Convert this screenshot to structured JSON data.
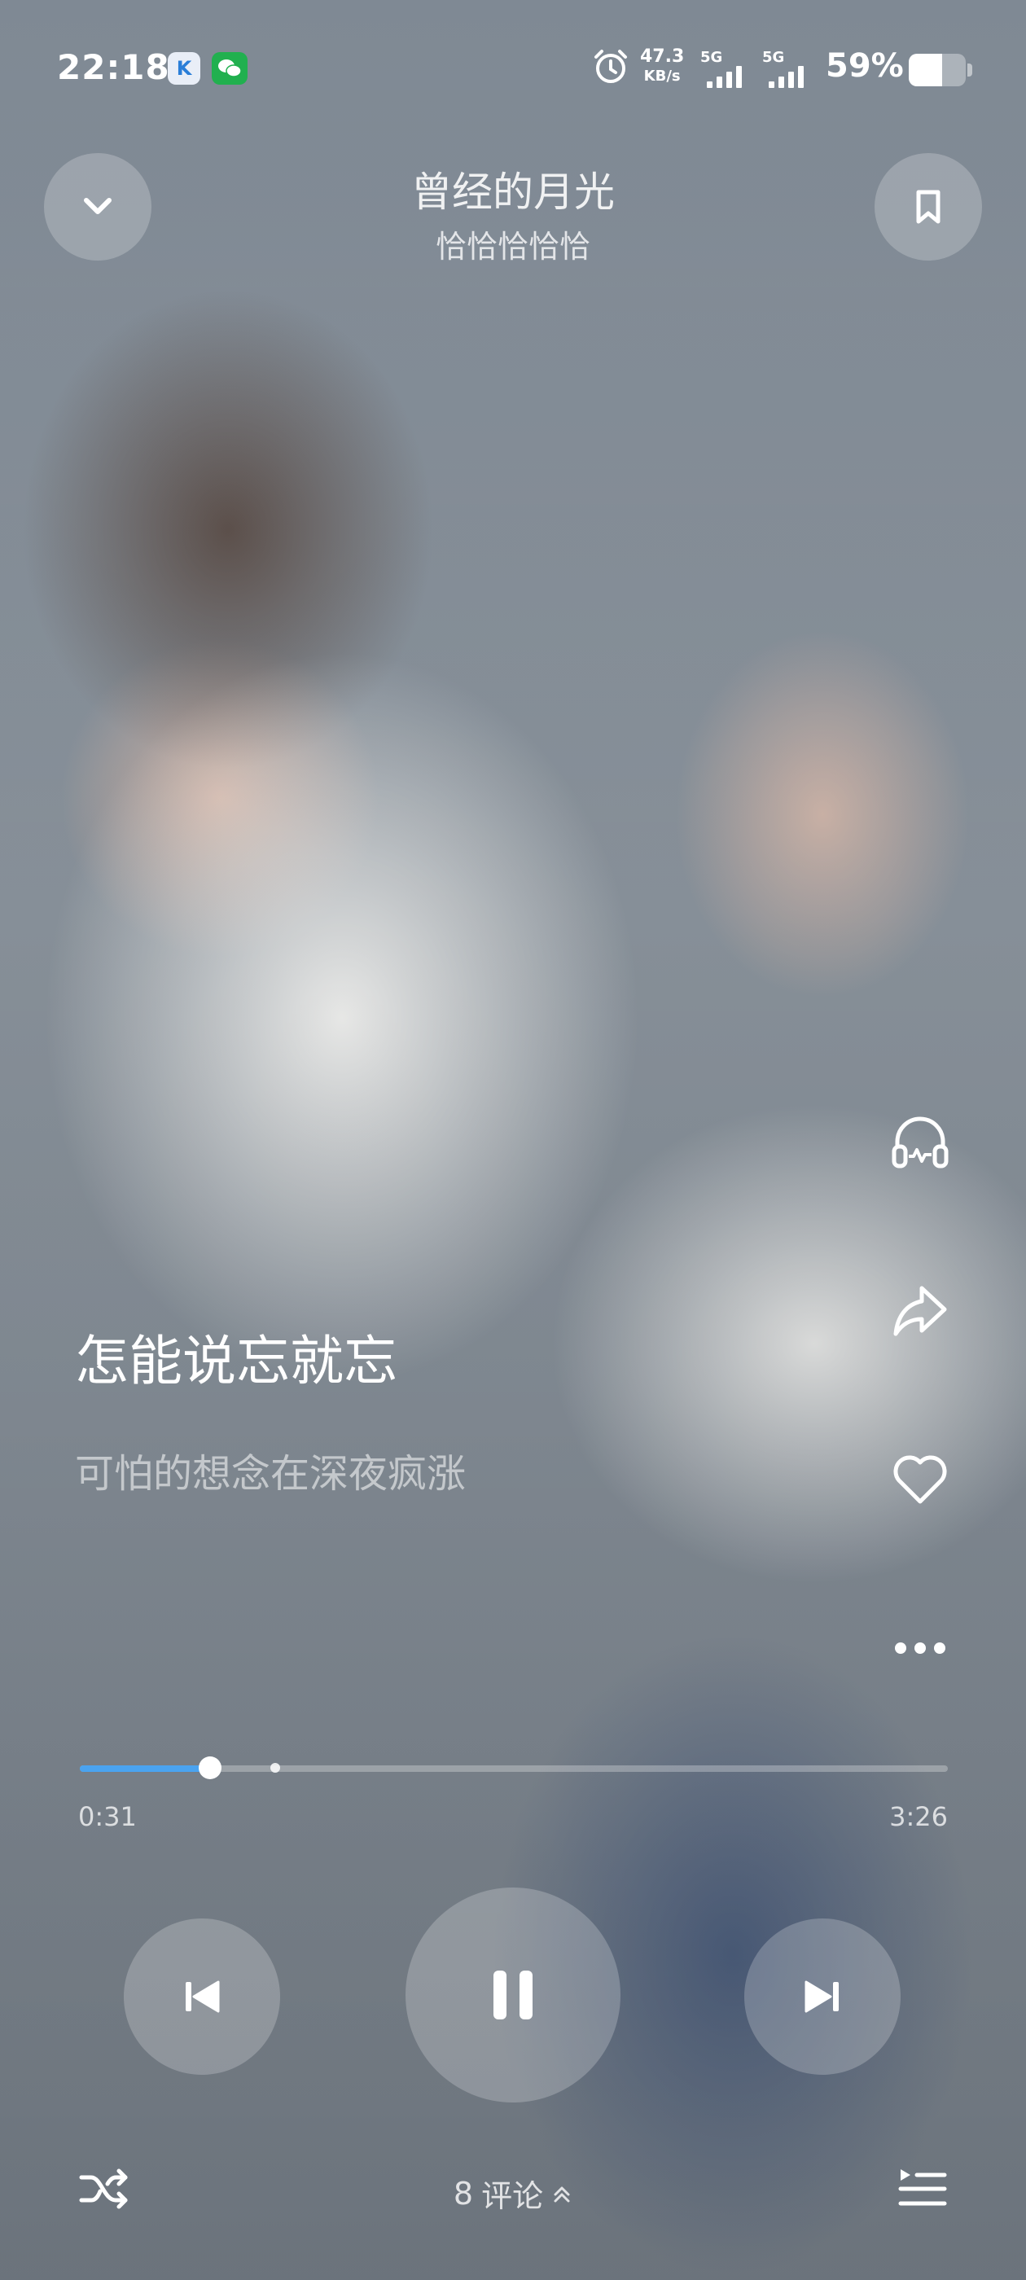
{
  "status_bar": {
    "time": "22:18",
    "app_icons": [
      "k-app-icon",
      "wechat-icon"
    ],
    "net_speed_value": "47.3",
    "net_speed_unit": "KB/s",
    "sim1_label": "5G",
    "sim2_label": "5G",
    "battery_percent_text": "59%",
    "battery_level": 0.59
  },
  "header": {
    "collapse_icon": "chevron-down-icon",
    "title": "曾经的月光",
    "artist": "恰恰恰恰恰",
    "bookmark_icon": "bookmark-icon"
  },
  "side_actions": [
    {
      "name": "sound-effect",
      "icon": "headphones-icon"
    },
    {
      "name": "share",
      "icon": "share-icon"
    },
    {
      "name": "like",
      "icon": "heart-icon"
    },
    {
      "name": "more",
      "icon": "more-icon"
    }
  ],
  "lyrics": {
    "current": "怎能说忘就忘",
    "next": "可怕的想念在深夜疯涨"
  },
  "progress": {
    "current_time": "0:31",
    "total_time": "3:26",
    "fraction": 0.15,
    "buffered_fraction": 0.225
  },
  "controls": {
    "previous_icon": "skip-previous-icon",
    "pause_icon": "pause-icon",
    "next_icon": "skip-next-icon"
  },
  "bottom_bar": {
    "shuffle_icon": "shuffle-icon",
    "comment_count": "8",
    "comment_label": "评论",
    "comment_arrow_icon": "chevron-up-icon",
    "playlist_icon": "playlist-icon"
  },
  "colors": {
    "progress_accent": "#4aa3f0",
    "wechat_green": "#21b04f"
  }
}
